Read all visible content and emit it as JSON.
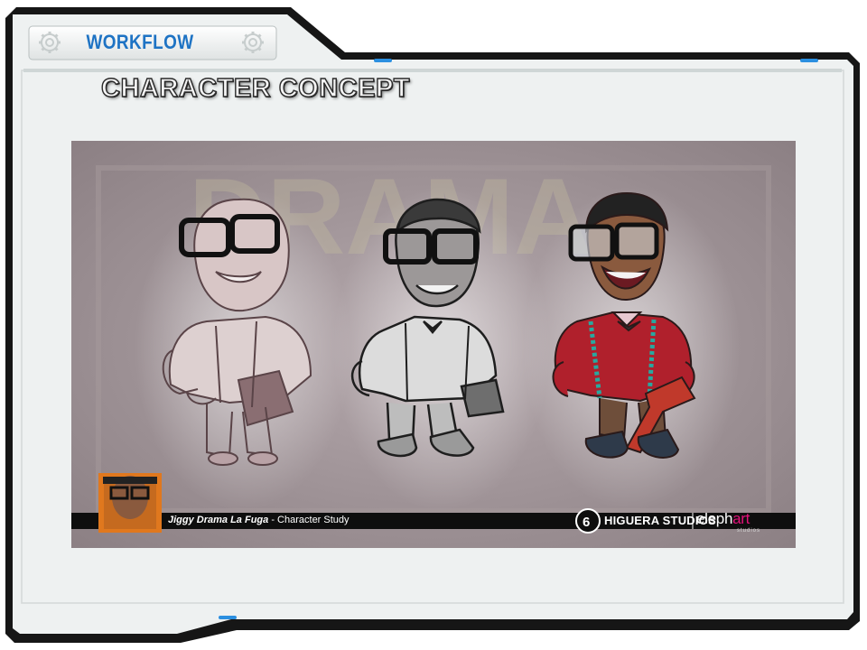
{
  "header": {
    "tab_label": "WORKFLOW",
    "title": "CHARACTER CONCEPT"
  },
  "artwork": {
    "watermark_text": "DRAMA",
    "caption": {
      "name": "Jiggy Drama La Fuga",
      "separator": " - ",
      "subtitle": "Character Study"
    },
    "brands": {
      "studio1": "HIGUERA STUDIOS",
      "studio2_part1": "eleph",
      "studio2_part2": "art",
      "studio2_sub": "studios"
    }
  },
  "colors": {
    "accent_blue": "#1e73c4",
    "frame_black": "#111111",
    "panel_bg": "#eef1f1",
    "brand_pink": "#e2127a",
    "sweater_red": "#b0202c"
  },
  "icons": [
    "gear-icon",
    "gear-icon",
    "logo-icon"
  ]
}
